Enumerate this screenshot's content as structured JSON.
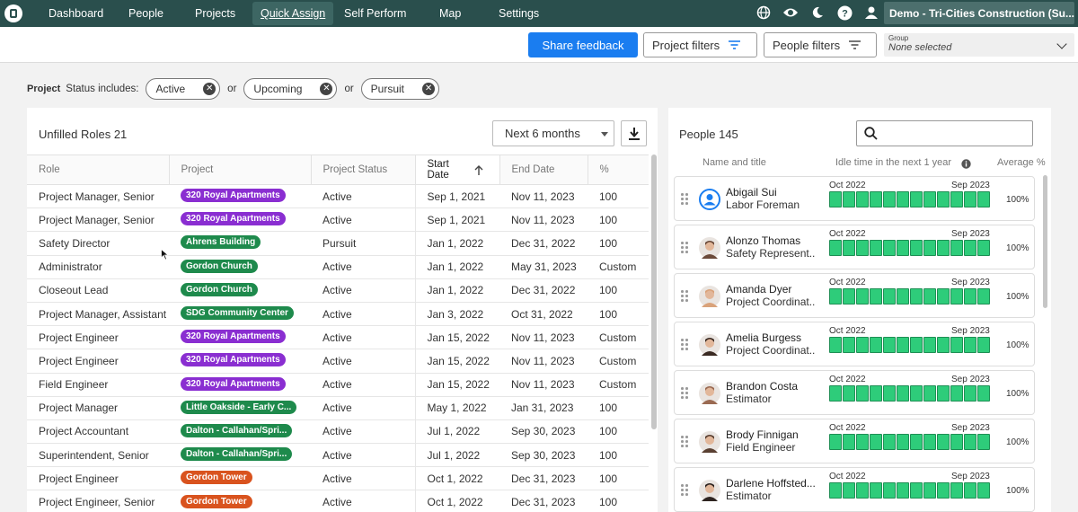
{
  "nav": {
    "items": [
      "Dashboard",
      "People",
      "Projects",
      "Quick Assign",
      "Self Perform",
      "Map",
      "Settings"
    ],
    "active": "Quick Assign",
    "icons": [
      "globe-icon",
      "eye-icon",
      "moon-icon",
      "help-icon",
      "user-icon"
    ],
    "tenant": "Demo - Tri-Cities Construction (Su..."
  },
  "toolbar": {
    "share_label": "Share feedback",
    "project_filters_label": "Project filters",
    "people_filters_label": "People filters",
    "group_label": "Group",
    "group_value": "None selected"
  },
  "filters": {
    "project_label": "Project",
    "status_label": "Status includes:",
    "or_label": "or",
    "chips": [
      "Active",
      "Upcoming",
      "Pursuit"
    ]
  },
  "roles": {
    "title": "Unfilled Roles 21",
    "range": "Next 6 months",
    "columns": [
      "Role",
      "Project",
      "Project Status",
      "Start Date",
      "End Date",
      "%"
    ],
    "rows": [
      {
        "role": "Project Manager, Senior",
        "project": "320 Royal Apartments",
        "color": "#8a2ed1",
        "status": "Active",
        "start": "Sep 1, 2021",
        "end": "Nov 11, 2023",
        "pct": "100"
      },
      {
        "role": "Project Manager, Senior",
        "project": "320 Royal Apartments",
        "color": "#8a2ed1",
        "status": "Active",
        "start": "Sep 1, 2021",
        "end": "Nov 11, 2023",
        "pct": "100"
      },
      {
        "role": "Safety Director",
        "project": "Ahrens Building",
        "color": "#1e8a4c",
        "status": "Pursuit",
        "start": "Jan 1, 2022",
        "end": "Dec 31, 2022",
        "pct": "100"
      },
      {
        "role": "Administrator",
        "project": "Gordon Church",
        "color": "#1e8a4c",
        "status": "Active",
        "start": "Jan 1, 2022",
        "end": "May 31, 2023",
        "pct": "Custom"
      },
      {
        "role": "Closeout Lead",
        "project": "Gordon Church",
        "color": "#1e8a4c",
        "status": "Active",
        "start": "Jan 1, 2022",
        "end": "Dec 31, 2022",
        "pct": "100"
      },
      {
        "role": "Project Manager, Assistant",
        "project": "SDG Community Center",
        "color": "#1e8a4c",
        "status": "Active",
        "start": "Jan 3, 2022",
        "end": "Oct 31, 2022",
        "pct": "100"
      },
      {
        "role": "Project Engineer",
        "project": "320 Royal Apartments",
        "color": "#8a2ed1",
        "status": "Active",
        "start": "Jan 15, 2022",
        "end": "Nov 11, 2023",
        "pct": "Custom"
      },
      {
        "role": "Project Engineer",
        "project": "320 Royal Apartments",
        "color": "#8a2ed1",
        "status": "Active",
        "start": "Jan 15, 2022",
        "end": "Nov 11, 2023",
        "pct": "Custom"
      },
      {
        "role": "Field Engineer",
        "project": "320 Royal Apartments",
        "color": "#8a2ed1",
        "status": "Active",
        "start": "Jan 15, 2022",
        "end": "Nov 11, 2023",
        "pct": "Custom"
      },
      {
        "role": "Project Manager",
        "project": "Little Oakside - Early C...",
        "color": "#1e8a4c",
        "status": "Active",
        "start": "May 1, 2022",
        "end": "Jan 31, 2023",
        "pct": "100"
      },
      {
        "role": "Project Accountant",
        "project": "Dalton - Callahan/Spri...",
        "color": "#1e8a4c",
        "status": "Active",
        "start": "Jul 1, 2022",
        "end": "Sep 30, 2023",
        "pct": "100"
      },
      {
        "role": "Superintendent, Senior",
        "project": "Dalton - Callahan/Spri...",
        "color": "#1e8a4c",
        "status": "Active",
        "start": "Jul 1, 2022",
        "end": "Sep 30, 2023",
        "pct": "100"
      },
      {
        "role": "Project Engineer",
        "project": "Gordon Tower",
        "color": "#d9531e",
        "status": "Active",
        "start": "Oct 1, 2022",
        "end": "Dec 31, 2023",
        "pct": "100"
      },
      {
        "role": "Project Engineer, Senior",
        "project": "Gordon Tower",
        "color": "#d9531e",
        "status": "Active",
        "start": "Oct 1, 2022",
        "end": "Dec 31, 2023",
        "pct": "100"
      }
    ]
  },
  "people": {
    "title": "People 145",
    "col_name": "Name and title",
    "col_idle": "Idle time in the next 1 year",
    "col_avg": "Average %",
    "from": "Oct 2022",
    "to": "Sep 2023",
    "list": [
      {
        "name": "Abigail Sui",
        "title": "Labor Foreman",
        "avg": "100%",
        "avatar": "#1a7df0"
      },
      {
        "name": "Alonzo Thomas",
        "title": "Safety Represent...",
        "avg": "100%",
        "avatar": "#6b4a3a"
      },
      {
        "name": "Amanda Dyer",
        "title": "Project Coordinat...",
        "avg": "100%",
        "avatar": "#d9a27a"
      },
      {
        "name": "Amelia Burgess",
        "title": "Project Coordinat...",
        "avg": "100%",
        "avatar": "#3a2a22"
      },
      {
        "name": "Brandon Costa",
        "title": "Estimator",
        "avg": "100%",
        "avatar": "#9a6a52"
      },
      {
        "name": "Brody Finnigan",
        "title": "Field Engineer",
        "avg": "100%",
        "avatar": "#5a4032"
      },
      {
        "name": "Darlene Hoffsted...",
        "title": "Estimator",
        "avg": "100%",
        "avatar": "#2e2420"
      }
    ]
  }
}
